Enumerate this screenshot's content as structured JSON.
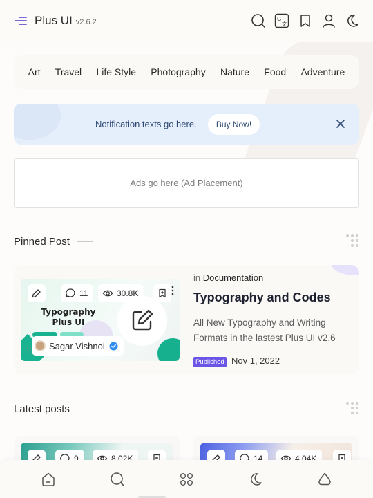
{
  "header": {
    "brand": "Plus UI",
    "version": "v2.6.2",
    "icons": [
      "menu-icon",
      "search-icon",
      "translate-icon",
      "bookmark-icon",
      "user-icon",
      "moon-icon"
    ]
  },
  "categories": [
    "Art",
    "Travel",
    "Life Style",
    "Photography",
    "Nature",
    "Food",
    "Adventure"
  ],
  "notification": {
    "text": "Notification texts go here.",
    "button": "Buy Now!"
  },
  "ad": {
    "text": "Ads go here (Ad Placement)"
  },
  "pinned": {
    "section_title": "Pinned Post",
    "post": {
      "meta_prefix": "in",
      "category": "Documentation",
      "title": "Typography and Codes",
      "description": "All New Typography and Writing Formats in the lastest Plus UI v2.6",
      "badge": "Published",
      "date": "Nov 1, 2022",
      "comments": "11",
      "views": "30.8K",
      "author": "Sagar Vishnoi",
      "thumb_title": "Typography Plus UI"
    }
  },
  "latest": {
    "section_title": "Latest posts",
    "posts": [
      {
        "comments": "9",
        "views": "8.02K"
      },
      {
        "comments": "14",
        "views": "4.04K"
      }
    ]
  },
  "colors": {
    "accent": "#6b55e6",
    "notification_bg": "#e5eefb",
    "teal": "#1ab391"
  },
  "bottom_nav": [
    "home-icon",
    "search-icon",
    "grid-icon",
    "moon-icon",
    "drop-icon"
  ]
}
